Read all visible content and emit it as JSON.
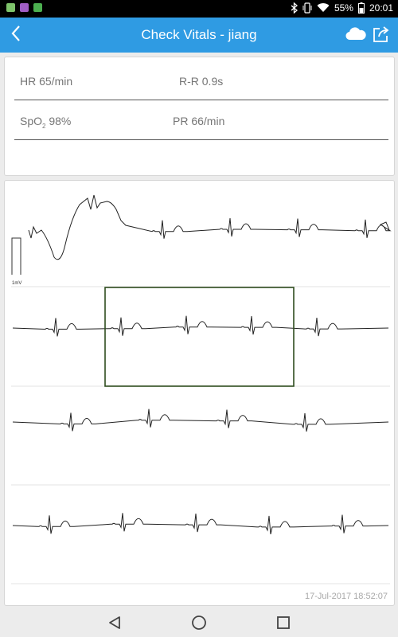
{
  "status_bar": {
    "battery": "55%",
    "time": "20:01",
    "app_icon_colors": [
      "#7ec36b",
      "#a05ec4",
      "#4caf50"
    ]
  },
  "header": {
    "title": "Check Vitals - jiang",
    "background": "#2f9be3"
  },
  "vitals": {
    "hr": "HR 65/min",
    "rr": "R-R 0.9s",
    "spo2_label": "SpO",
    "spo2_sub": "2",
    "spo2_value": " 98%",
    "pr": "PR 66/min"
  },
  "ecg": {
    "calibration_label": "1mV",
    "timestamp": "17-Jul-2017 18:52:07",
    "selection_color": "#2e4d1e"
  }
}
